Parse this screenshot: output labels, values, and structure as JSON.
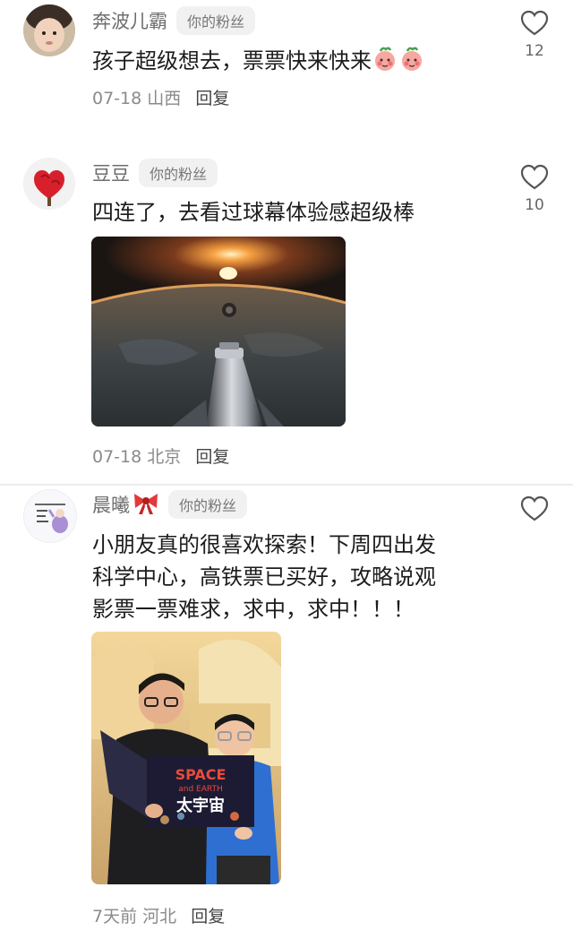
{
  "comments": [
    {
      "username": "奔波儿霸",
      "badge": "你的粉丝",
      "text": "孩子超级想去，票票快来快来",
      "emojis": [
        "peach-face-emoji",
        "peach-face-emoji"
      ],
      "date": "07-18",
      "location": "山西",
      "reply": "回复",
      "likes": "12"
    },
    {
      "username": "豆豆",
      "badge": "你的粉丝",
      "text": "四连了，去看过球幕体验感超级棒",
      "date": "07-18",
      "location": "北京",
      "reply": "回复",
      "likes": "10",
      "image": "space-earth-rocket-photo"
    },
    {
      "username": "晨曦",
      "username_emoji": "red-bow-emoji",
      "badge": "你的粉丝",
      "text_lines": [
        "小朋友真的很喜欢探索！下周四出发",
        "科学中心，高铁票已买好，攻略说观",
        "影票一票难求，求中，求中！！！"
      ],
      "date": "7天前",
      "location": "河北",
      "reply": "回复",
      "likes": "",
      "image": "father-son-reading-space-book-photo",
      "book_title": "SPACE",
      "book_subtitle": "and EARTH",
      "book_cn_title": "太宇宙"
    }
  ],
  "colors": {
    "username": "#6e6e6e",
    "badge_bg": "#f1f1f1",
    "meta": "#8a8a8a",
    "heart_stroke": "#555555"
  }
}
